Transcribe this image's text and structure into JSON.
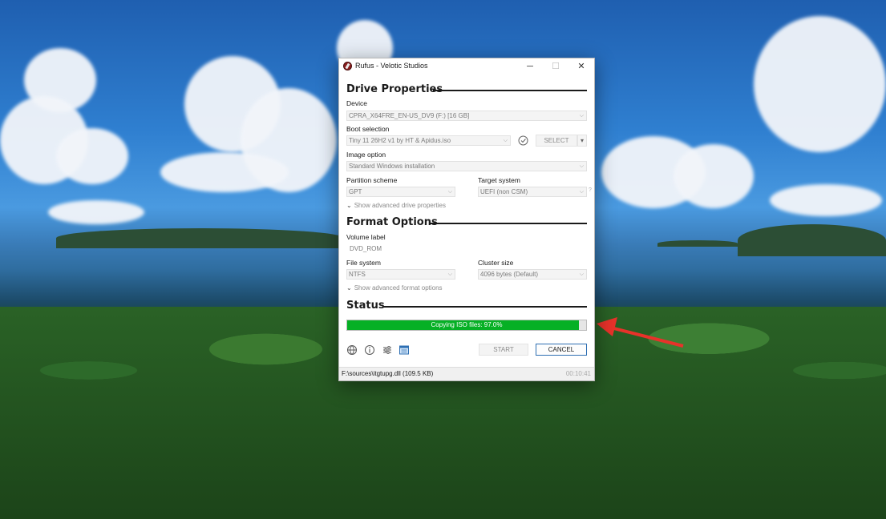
{
  "window": {
    "title": "Rufus - Velotic Studios",
    "controls": {
      "minimize": "─",
      "maximize": "☐",
      "close": "✕"
    }
  },
  "drive_properties": {
    "header": "Drive Properties",
    "device_label": "Device",
    "device_value": "CPRA_X64FRE_EN-US_DV9 (F:) [16 GB]",
    "boot_selection_label": "Boot selection",
    "boot_selection_value": "Tiny 11 26H2 v1 by HT & Apidus.iso",
    "select_button": "SELECT",
    "image_option_label": "Image option",
    "image_option_value": "Standard Windows installation",
    "partition_scheme_label": "Partition scheme",
    "partition_scheme_value": "GPT",
    "target_system_label": "Target system",
    "target_system_value": "UEFI (non CSM)",
    "target_help": "?",
    "advanced_toggle": "Show advanced drive properties"
  },
  "format_options": {
    "header": "Format Options",
    "volume_label_label": "Volume label",
    "volume_label_value": "DVD_ROM",
    "file_system_label": "File system",
    "file_system_value": "NTFS",
    "cluster_size_label": "Cluster size",
    "cluster_size_value": "4096 bytes (Default)",
    "advanced_toggle": "Show advanced format options"
  },
  "status": {
    "header": "Status",
    "progress_text": "Copying ISO files: 97.0%",
    "progress_fraction": 0.97,
    "progress_color": "#06b025"
  },
  "toolbar": {
    "icons": [
      "globe-icon",
      "info-icon",
      "settings-icon",
      "log-icon"
    ],
    "start_button": "START",
    "cancel_button": "CANCEL"
  },
  "status_bar": {
    "file_text": "F:\\sources\\itgtupg.dll (109.5 KB)",
    "elapsed": "00:10:41"
  }
}
